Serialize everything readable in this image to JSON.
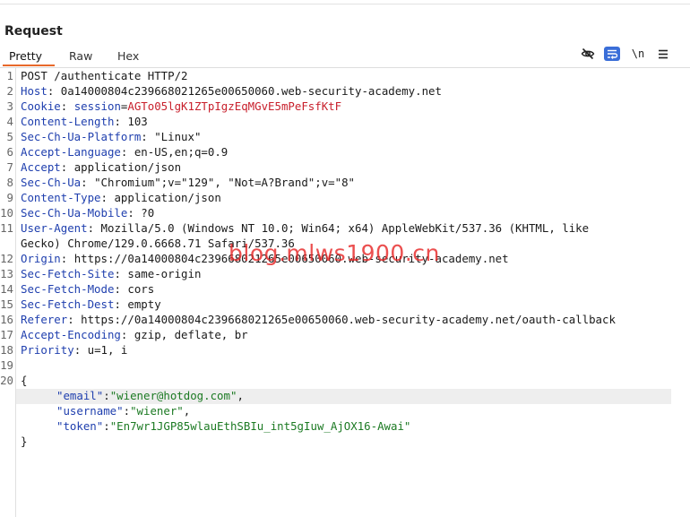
{
  "panel": {
    "title": "Request",
    "tabs": [
      "Pretty",
      "Raw",
      "Hex"
    ],
    "active_tab": "Pretty"
  },
  "toolbar": {
    "icons": [
      "eye-slash-icon",
      "wrap-lines-icon",
      "newline-icon",
      "menu-icon"
    ],
    "newline_label": "\\n",
    "accent_color": "#3a6ed8"
  },
  "request": {
    "line1": {
      "n": "1",
      "text": "POST /authenticate HTTP/2"
    },
    "line2": {
      "n": "2",
      "name": "Host",
      "value": "0a14000804c239668021265e00650060.web-security-academy.net"
    },
    "line3": {
      "n": "3",
      "name": "Cookie",
      "cookie_name": "session",
      "cookie_value": "AGTo05lgK1ZTpIgzEqMGvE5mPeFsfKtF"
    },
    "line4": {
      "n": "4",
      "name": "Content-Length",
      "value": "103"
    },
    "line5": {
      "n": "5",
      "name": "Sec-Ch-Ua-Platform",
      "value": "\"Linux\""
    },
    "line6": {
      "n": "6",
      "name": "Accept-Language",
      "value": "en-US,en;q=0.9"
    },
    "line7": {
      "n": "7",
      "name": "Accept",
      "value": "application/json"
    },
    "line8": {
      "n": "8",
      "name": "Sec-Ch-Ua",
      "value": "\"Chromium\";v=\"129\", \"Not=A?Brand\";v=\"8\""
    },
    "line9": {
      "n": "9",
      "name": "Content-Type",
      "value": "application/json"
    },
    "line10": {
      "n": "10",
      "name": "Sec-Ch-Ua-Mobile",
      "value": "?0"
    },
    "line11": {
      "n": "11",
      "name": "User-Agent",
      "value": "Mozilla/5.0 (Windows NT 10.0; Win64; x64) AppleWebKit/537.36 (KHTML, like",
      "cont": "Gecko) Chrome/129.0.6668.71 Safari/537.36"
    },
    "line12": {
      "n": "12",
      "name": "Origin",
      "value": "https://0a14000804c239668021265e00650060.web-security-academy.net"
    },
    "line13": {
      "n": "13",
      "name": "Sec-Fetch-Site",
      "value": "same-origin"
    },
    "line14": {
      "n": "14",
      "name": "Sec-Fetch-Mode",
      "value": "cors"
    },
    "line15": {
      "n": "15",
      "name": "Sec-Fetch-Dest",
      "value": "empty"
    },
    "line16": {
      "n": "16",
      "name": "Referer",
      "value": "https://0a14000804c239668021265e00650060.web-security-academy.net/oauth-callback"
    },
    "line17": {
      "n": "17",
      "name": "Accept-Encoding",
      "value": "gzip, deflate, br"
    },
    "line18": {
      "n": "18",
      "name": "Priority",
      "value": "u=1, i"
    },
    "line19": {
      "n": "19"
    },
    "line20": {
      "n": "20",
      "text": "{"
    },
    "json_email_key": "\"email\"",
    "json_email_val": "\"wiener@hotdog.com\"",
    "json_username_key": "\"username\"",
    "json_username_val": "\"wiener\"",
    "json_token_key": "\"token\"",
    "json_token_val": "\"En7wr1JGP85wlauEthSBIu_int5gIuw_AjOX16-Awai\"",
    "closing_brace": "}"
  },
  "watermark": "blog.mlws1900.cn"
}
